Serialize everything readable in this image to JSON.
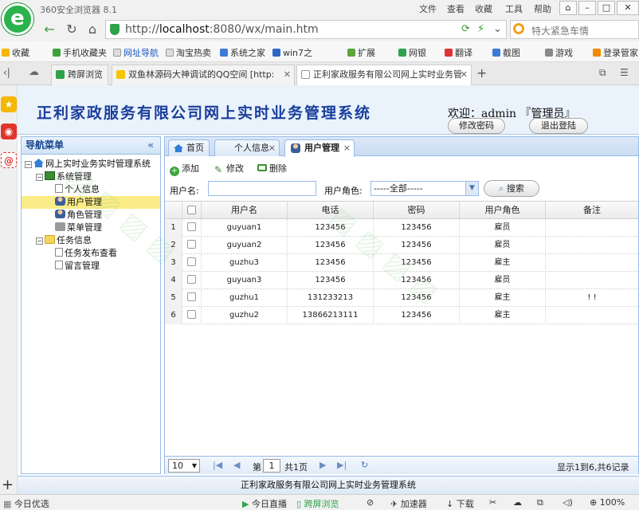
{
  "browser": {
    "app_title": "360安全浏览器 8.1",
    "menu": [
      "文件",
      "查看",
      "收藏",
      "工具",
      "帮助"
    ],
    "url_prefix": "http://",
    "url_host": "localhost",
    "url_rest": ":8080/wx/main.htm",
    "search_placeholder": "特大紧急车情",
    "bookmarks": [
      "收藏",
      "手机收藏夹",
      "网址导航",
      "淘宝热卖",
      "系统之家",
      "win7之",
      "扩展",
      "网银",
      "翻译",
      "截图",
      "游戏",
      "登录管家"
    ],
    "tabs": [
      {
        "label": "跨屏浏览"
      },
      {
        "label": "双鱼林源码大神调试的QQ空间 [http:"
      },
      {
        "label": "正利家政服务有限公司网上实时业务管"
      }
    ],
    "status": {
      "left": "今日优选",
      "live": "今日直播",
      "cross": "跨屏浏览",
      "speed": "加速器",
      "download": "下载",
      "zoom": "100%"
    }
  },
  "app": {
    "system_title": "正利家政服务有限公司网上实时业务管理系统",
    "welcome": "欢迎：admin 『管理员』",
    "change_password": "修改密码",
    "logout": "退出登陆",
    "nav_title": "导航菜单",
    "nav_collapse": "«",
    "tree": {
      "root": "网上实时业务实时管理系统",
      "system_mgmt": "系统管理",
      "personal_info": "个人信息",
      "user_mgmt": "用户管理",
      "role_mgmt": "角色管理",
      "menu_mgmt": "菜单管理",
      "task_info": "任务信息",
      "task_publish": "任务发布查看",
      "message_mgmt": "留言管理"
    },
    "tabs": {
      "home": "首页",
      "personal": "个人信息",
      "users": "用户管理"
    },
    "toolbar": {
      "add": "添加",
      "edit": "修改",
      "delete": "删除"
    },
    "filter": {
      "username_label": "用户名:",
      "username_value": "",
      "role_label": "用户角色:",
      "role_selected": "-----全部-----",
      "search": "搜索"
    },
    "grid": {
      "columns": [
        "用户名",
        "电话",
        "密码",
        "用户角色",
        "备注"
      ],
      "rows": [
        {
          "num": "1",
          "username": "guyuan1",
          "phone": "123456",
          "password": "123456",
          "role": "雇员",
          "note": ""
        },
        {
          "num": "2",
          "username": "guyuan2",
          "phone": "123456",
          "password": "123456",
          "role": "雇员",
          "note": ""
        },
        {
          "num": "3",
          "username": "guzhu3",
          "phone": "123456",
          "password": "123456",
          "role": "雇主",
          "note": ""
        },
        {
          "num": "4",
          "username": "guyuan3",
          "phone": "123456",
          "password": "123456",
          "role": "雇员",
          "note": ""
        },
        {
          "num": "5",
          "username": "guzhu1",
          "phone": "131233213",
          "password": "123456",
          "role": "雇主",
          "note": "! !"
        },
        {
          "num": "6",
          "username": "guzhu2",
          "phone": "13866213111",
          "password": "123456",
          "role": "雇主",
          "note": ""
        }
      ]
    },
    "pager": {
      "page_size": "10",
      "page_prefix": "第",
      "page_value": "1",
      "page_suffix": "共1页",
      "summary": "显示1到6,共6记录"
    },
    "footer": "正利家政服务有限公司网上实时业务管理系统"
  },
  "colors": {
    "brand_green": "#2bb24c",
    "header_blue": "#1a3f9c",
    "panel_border": "#99bbe8",
    "selected_row": "#fbec88"
  }
}
